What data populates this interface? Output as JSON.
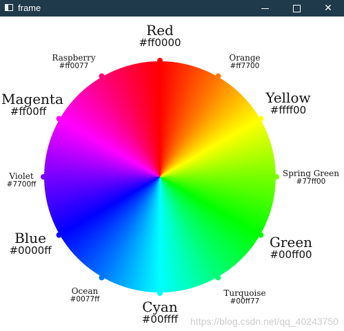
{
  "window": {
    "title": "frame",
    "minimize_icon": "minimize-icon",
    "maximize_icon": "maximize-icon",
    "close_icon": "close-icon"
  },
  "wheel": {
    "colors": [
      {
        "name": "Red",
        "hex": "#ff0000"
      },
      {
        "name": "Orange",
        "hex": "#ff7700"
      },
      {
        "name": "Yellow",
        "hex": "#ffff00"
      },
      {
        "name": "Spring Green",
        "hex": "#77ff00"
      },
      {
        "name": "Green",
        "hex": "#00ff00"
      },
      {
        "name": "Turquoise",
        "hex": "#00ff77"
      },
      {
        "name": "Cyan",
        "hex": "#00ffff"
      },
      {
        "name": "Ocean",
        "hex": "#0077ff"
      },
      {
        "name": "Blue",
        "hex": "#0000ff"
      },
      {
        "name": "Violet",
        "hex": "#7700ff"
      },
      {
        "name": "Magenta",
        "hex": "#ff00ff"
      },
      {
        "name": "Raspberry",
        "hex": "#ff0077"
      }
    ],
    "labels": {
      "red": {
        "name": "Red",
        "hex": "#ff0000"
      },
      "orange": {
        "name": "Orange",
        "hex": "#ff7700"
      },
      "yellow": {
        "name": "Yellow",
        "hex": "#ffff00"
      },
      "spring_green": {
        "name": "Spring Green",
        "hex": "#77ff00"
      },
      "green": {
        "name": "Green",
        "hex": "#00ff00"
      },
      "turquoise": {
        "name": "Turquoise",
        "hex": "#00ff77"
      },
      "cyan": {
        "name": "Cyan",
        "hex": "#00ffff"
      },
      "ocean": {
        "name": "Ocean",
        "hex": "#0077ff"
      },
      "blue": {
        "name": "Blue",
        "hex": "#0000ff"
      },
      "violet": {
        "name": "Violet",
        "hex": "#7700ff"
      },
      "magenta": {
        "name": "Magenta",
        "hex": "#ff00ff"
      },
      "raspberry": {
        "name": "Raspberry",
        "hex": "#ff0077"
      }
    }
  },
  "watermark": "https://blog.csdn.net/qq_40243750"
}
